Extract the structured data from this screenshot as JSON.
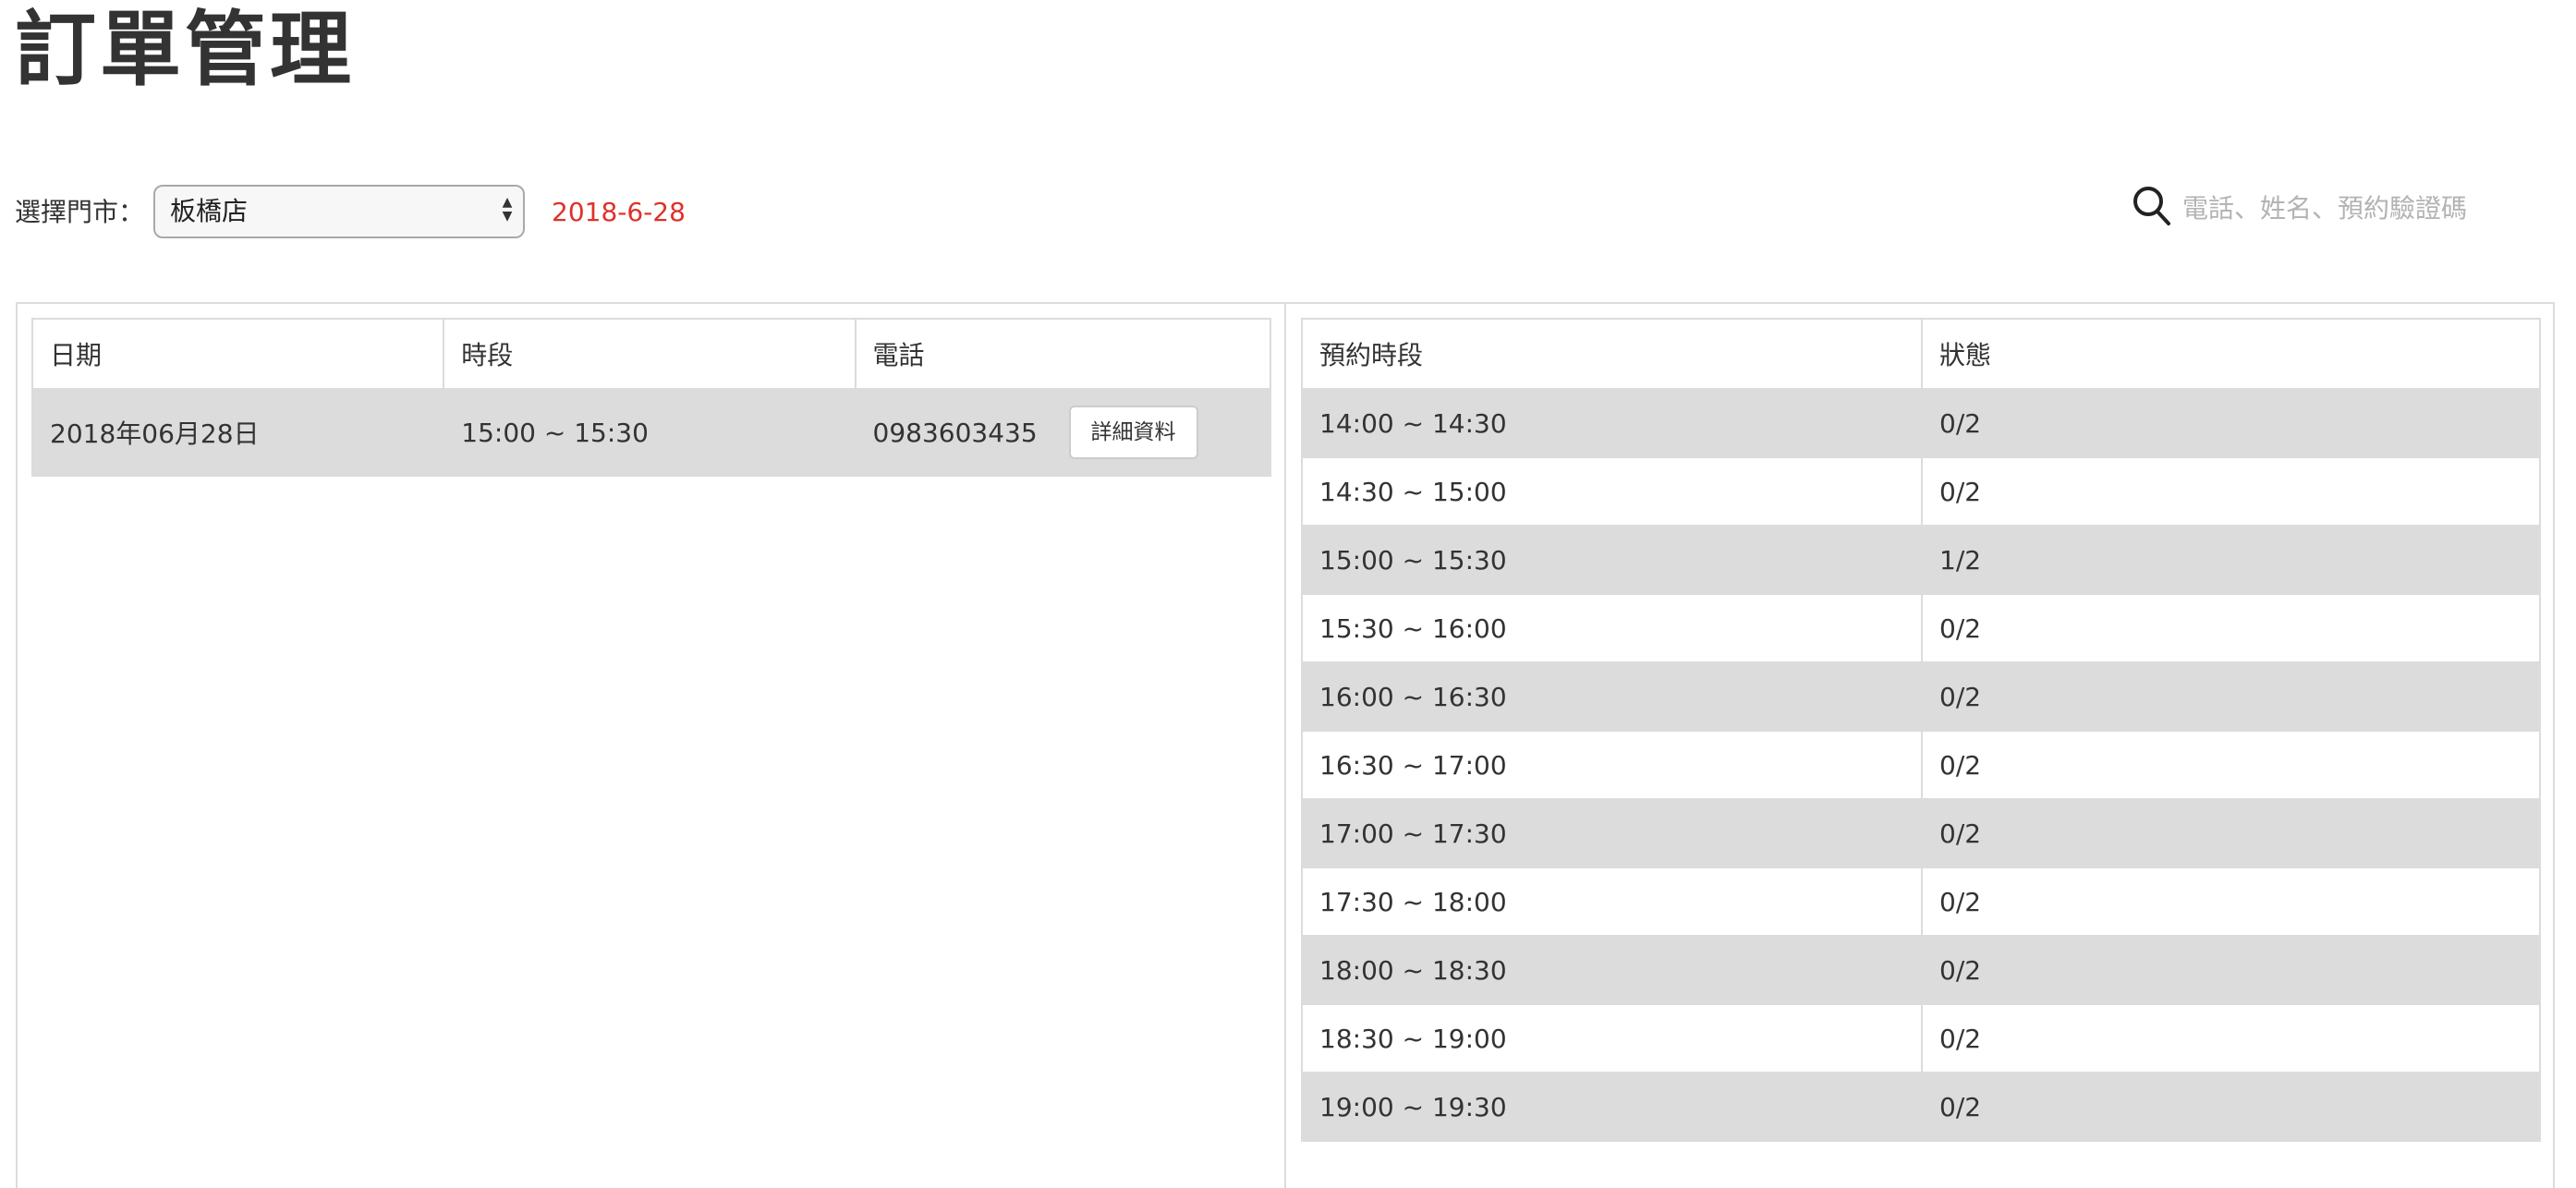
{
  "page_title": "訂單管理",
  "store_filter": {
    "label": "選擇門市：",
    "selected": "板橋店"
  },
  "selected_date": "2018-6-28",
  "search": {
    "placeholder": "電話、姓名、預約驗證碼",
    "value": ""
  },
  "orders_table": {
    "headers": [
      "日期",
      "時段",
      "電話"
    ],
    "rows": [
      {
        "date": "2018年06月28日",
        "slot": "15:00 ~ 15:30",
        "phone": "0983603435",
        "detail_label": "詳細資料"
      }
    ]
  },
  "slots_table": {
    "headers": [
      "預約時段",
      "狀態"
    ],
    "rows": [
      {
        "slot": "14:00 ~ 14:30",
        "status": "0/2"
      },
      {
        "slot": "14:30 ~ 15:00",
        "status": "0/2"
      },
      {
        "slot": "15:00 ~ 15:30",
        "status": "1/2"
      },
      {
        "slot": "15:30 ~ 16:00",
        "status": "0/2"
      },
      {
        "slot": "16:00 ~ 16:30",
        "status": "0/2"
      },
      {
        "slot": "16:30 ~ 17:00",
        "status": "0/2"
      },
      {
        "slot": "17:00 ~ 17:30",
        "status": "0/2"
      },
      {
        "slot": "17:30 ~ 18:00",
        "status": "0/2"
      },
      {
        "slot": "18:00 ~ 18:30",
        "status": "0/2"
      },
      {
        "slot": "18:30 ~ 19:00",
        "status": "0/2"
      },
      {
        "slot": "19:00 ~ 19:30",
        "status": "0/2"
      }
    ]
  },
  "colors": {
    "date_text": "#e0302a",
    "row_shade": "#dcdcdc",
    "border": "#dcdcdc"
  },
  "icons": {
    "search": "search-icon",
    "select_arrows": "select-arrows-icon"
  }
}
